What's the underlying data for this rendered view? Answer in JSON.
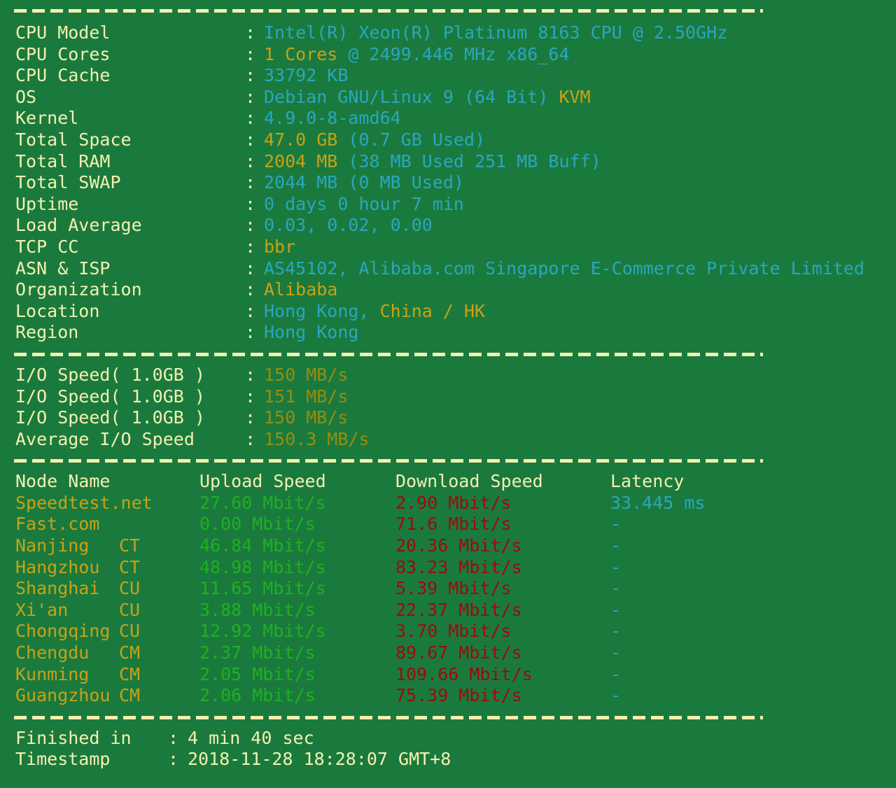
{
  "theme": {
    "background": "#1a7a3e",
    "label_color": "#f5f0b0",
    "cyan": "#2aa6bf",
    "gold": "#c8a215",
    "olive": "#9a8c0c",
    "green": "#1fb01f",
    "red": "#9e0a0a"
  },
  "system_info": {
    "rows": [
      {
        "label": "CPU Model",
        "colon": ":",
        "segments": [
          {
            "text": "Intel(R) Xeon(R) Platinum 8163 CPU @ 2.50GHz",
            "color": "cyan"
          }
        ]
      },
      {
        "label": "CPU Cores",
        "colon": ":",
        "segments": [
          {
            "text": "1 Cores ",
            "color": "gold"
          },
          {
            "text": "@ 2499.446 MHz x86_64",
            "color": "cyan"
          }
        ]
      },
      {
        "label": "CPU Cache",
        "colon": ":",
        "segments": [
          {
            "text": "33792 KB",
            "color": "cyan"
          }
        ]
      },
      {
        "label": "OS",
        "colon": ":",
        "segments": [
          {
            "text": "Debian GNU/Linux 9 (64 Bit) ",
            "color": "cyan"
          },
          {
            "text": "KVM",
            "color": "gold"
          }
        ]
      },
      {
        "label": "Kernel",
        "colon": ":",
        "segments": [
          {
            "text": "4.9.0-8-amd64",
            "color": "cyan"
          }
        ]
      },
      {
        "label": "Total Space",
        "colon": ":",
        "segments": [
          {
            "text": "47.0 GB ",
            "color": "gold"
          },
          {
            "text": "(0.7 GB Used)",
            "color": "cyan"
          }
        ]
      },
      {
        "label": "Total RAM",
        "colon": ":",
        "segments": [
          {
            "text": "2004 MB ",
            "color": "gold"
          },
          {
            "text": "(38 MB Used 251 MB Buff)",
            "color": "cyan"
          }
        ]
      },
      {
        "label": "Total SWAP",
        "colon": ":",
        "segments": [
          {
            "text": "2044 MB (0 MB Used)",
            "color": "cyan"
          }
        ]
      },
      {
        "label": "Uptime",
        "colon": ":",
        "segments": [
          {
            "text": "0 days 0 hour 7 min",
            "color": "cyan"
          }
        ]
      },
      {
        "label": "Load Average",
        "colon": ":",
        "segments": [
          {
            "text": "0.03, 0.02, 0.00",
            "color": "cyan"
          }
        ]
      },
      {
        "label": "TCP CC",
        "colon": ":",
        "segments": [
          {
            "text": "bbr",
            "color": "gold"
          }
        ]
      },
      {
        "label": "ASN & ISP",
        "colon": ":",
        "segments": [
          {
            "text": "AS45102, Alibaba.com Singapore E-Commerce Private Limited",
            "color": "cyan"
          }
        ]
      },
      {
        "label": "Organization",
        "colon": ":",
        "segments": [
          {
            "text": "Alibaba",
            "color": "gold"
          }
        ]
      },
      {
        "label": "Location",
        "colon": ":",
        "segments": [
          {
            "text": "Hong Kong, ",
            "color": "cyan"
          },
          {
            "text": "China / HK",
            "color": "gold"
          }
        ]
      },
      {
        "label": "Region",
        "colon": ":",
        "segments": [
          {
            "text": "Hong Kong",
            "color": "cyan"
          }
        ]
      }
    ]
  },
  "io_test": {
    "rows": [
      {
        "label": "I/O Speed( 1.0GB )",
        "colon": ":",
        "value": "150 MB/s"
      },
      {
        "label": "I/O Speed( 1.0GB )",
        "colon": ":",
        "value": "151 MB/s"
      },
      {
        "label": "I/O Speed( 1.0GB )",
        "colon": ":",
        "value": "150 MB/s"
      },
      {
        "label": "Average I/O Speed",
        "colon": ":",
        "value": "150.3 MB/s"
      }
    ]
  },
  "node_table": {
    "headers": {
      "node_name": "Node Name",
      "upload": "Upload Speed",
      "download": "Download Speed",
      "latency": "Latency"
    },
    "rows": [
      {
        "name": "Speedtest.net",
        "isp": "",
        "upload": "27.60 Mbit/s",
        "download": "2.90 Mbit/s",
        "latency": "33.445 ms"
      },
      {
        "name": "Fast.com",
        "isp": "",
        "upload": "0.00 Mbit/s",
        "download": "71.6 Mbit/s",
        "latency": "-"
      },
      {
        "name": "Nanjing",
        "isp": "CT",
        "upload": "46.84 Mbit/s",
        "download": "20.36 Mbit/s",
        "latency": "-"
      },
      {
        "name": "Hangzhou",
        "isp": "CT",
        "upload": "48.98 Mbit/s",
        "download": "83.23 Mbit/s",
        "latency": "-"
      },
      {
        "name": "Shanghai",
        "isp": "CU",
        "upload": "11.65 Mbit/s",
        "download": "5.39 Mbit/s",
        "latency": "-"
      },
      {
        "name": "Xi'an",
        "isp": "CU",
        "upload": "3.88 Mbit/s",
        "download": "22.37 Mbit/s",
        "latency": "-"
      },
      {
        "name": "Chongqing",
        "isp": "CU",
        "upload": "12.92 Mbit/s",
        "download": "3.70 Mbit/s",
        "latency": "-"
      },
      {
        "name": "Chengdu",
        "isp": "CM",
        "upload": "2.37 Mbit/s",
        "download": "89.67 Mbit/s",
        "latency": "-"
      },
      {
        "name": "Kunming",
        "isp": "CM",
        "upload": "2.05 Mbit/s",
        "download": "109.66 Mbit/s",
        "latency": "-"
      },
      {
        "name": "Guangzhou",
        "isp": "CM",
        "upload": "2.06 Mbit/s",
        "download": "75.39 Mbit/s",
        "latency": "-"
      }
    ]
  },
  "footer": {
    "rows": [
      {
        "label": "Finished in",
        "colon": ":",
        "value": "4 min 40 sec"
      },
      {
        "label": "Timestamp",
        "colon": ":",
        "value": "2018-11-28 18:28:07 GMT+8"
      }
    ]
  }
}
